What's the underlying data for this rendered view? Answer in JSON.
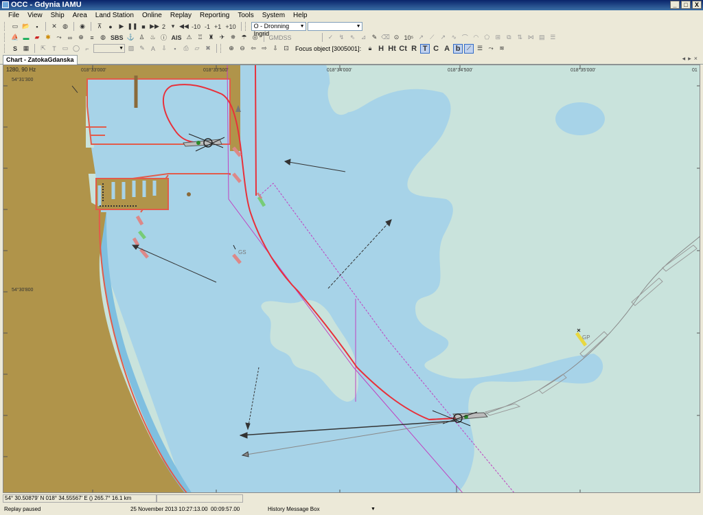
{
  "window": {
    "title": "OCC - Gdynia IAMU",
    "min": "_",
    "max": "□",
    "close": "X"
  },
  "menu": [
    "File",
    "View",
    "Ship",
    "Area",
    "Land Station",
    "Online",
    "Replay",
    "Reporting",
    "Tools",
    "System",
    "Help"
  ],
  "toolbar1": {
    "replay_speed": "2",
    "step_minus10": "-10",
    "step_minus1": "-1",
    "step_plus1": "+1",
    "step_plus10": "+10",
    "ship_select": "O - Dronning Ingrid"
  },
  "toolbar2": {
    "sbs": "SBS",
    "ais": "AIS",
    "gmdss": "GMDSS",
    "ten5": "10⁵"
  },
  "toolbar3": {
    "focus_label": "Focus object [3005001]:",
    "mode_buttons": [
      "H",
      "Ht",
      "Ct",
      "R",
      "T",
      "C",
      "A",
      "b"
    ]
  },
  "tab": {
    "label": "Chart - ZatokaGdanska"
  },
  "chart": {
    "scale": "1280, 90 Hz",
    "lon_labels": [
      "018°33'000'",
      "018°33'500'",
      "018°34'000'",
      "018°34'500'",
      "018°35'000'",
      "01"
    ],
    "lat_labels": [
      "54°31'300",
      "54°30'800"
    ],
    "labels": {
      "gs": "GS",
      "gp": "GP"
    },
    "colors": {
      "land": "#b0944a",
      "shallow": "#9fcfe7",
      "deep": "#a9d4e6",
      "sea_green": "#c9e3dc",
      "track": "#e8303a",
      "boundary": "#c040c0"
    }
  },
  "status": {
    "coords": "54° 30.50879' N 018° 34.55567' E () 265.7° 16.1 km",
    "replay": "Replay paused",
    "datetime": "25 November 2013 10:27:13.00",
    "elapsed": "00:09:57.00",
    "message_box": "History Message Box"
  }
}
